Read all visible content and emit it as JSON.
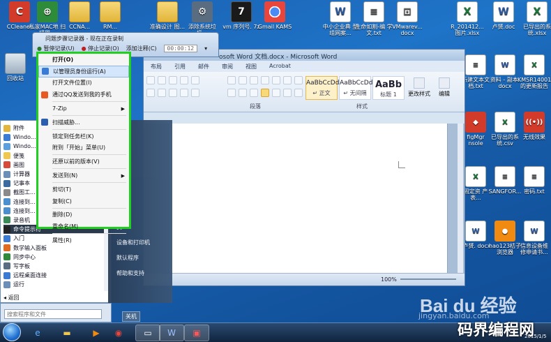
{
  "desktop_icons": [
    {
      "label": "CCleaner",
      "icon": "ccleaner-icon",
      "kind": "ico-red",
      "glyph": "C"
    },
    {
      "label": "私家MAC地 扫描器...",
      "icon": "scanner-icon",
      "kind": "ico-green",
      "glyph": "⊕"
    },
    {
      "label": "CCNA...",
      "icon": "folder-icon",
      "kind": "ico-folder",
      "glyph": ""
    },
    {
      "label": "RM...",
      "icon": "folder-icon",
      "kind": "ico-folder",
      "glyph": ""
    },
    {
      "label": "准确设计 图...",
      "icon": "folder-icon",
      "kind": "ico-folder",
      "glyph": ""
    },
    {
      "label": "添除系统垃 圾...",
      "icon": "gear-icon",
      "kind": "ico-gear",
      "glyph": "⚙"
    },
    {
      "label": "vm 序列号. 7z",
      "icon": "7z-icon",
      "kind": "ico-7z",
      "glyph": "7"
    },
    {
      "label": "Gmail KAMS",
      "icon": "chrome-icon",
      "kind": "ico-chrome",
      "glyph": ""
    },
    {
      "label": "中小企业典 型组网案...",
      "icon": "word-doc-icon",
      "kind": "ico-word",
      "glyph": "W"
    },
    {
      "label": "生命如割-编 学文.txt",
      "icon": "text-file-icon",
      "kind": "ico-text",
      "glyph": "≡"
    },
    {
      "label": "VMwarev... docx",
      "icon": "pdf-icon",
      "kind": "ico-text",
      "glyph": "⊡"
    },
    {
      "label": "R_201412... 图片.xlsx",
      "icon": "excel-icon",
      "kind": "ico-excel",
      "glyph": "X"
    },
    {
      "label": "卢赟.doc",
      "icon": "word-doc-icon",
      "kind": "ico-word",
      "glyph": "W"
    },
    {
      "label": "已导出的系 统.xlsx",
      "icon": "excel-icon",
      "kind": "ico-excel",
      "glyph": "X"
    }
  ],
  "right_icons": [
    {
      "label": "回收站",
      "icon": "recycle-bin-icon",
      "kind": "ico-bin",
      "glyph": ""
    },
    {
      "label": "新建文本文 档.txt",
      "icon": "text-file-icon",
      "kind": "ico-text",
      "glyph": "≡"
    },
    {
      "label": "资料 - 副本. docx",
      "icon": "word-doc-icon",
      "kind": "ico-word",
      "glyph": "W"
    },
    {
      "label": "KMSR14001 的更新报告",
      "icon": "excel-icon",
      "kind": "ico-excel",
      "glyph": "X"
    },
    {
      "label": "figMgr nsole",
      "icon": "app-icon",
      "kind": "ico-red",
      "glyph": "◆"
    },
    {
      "label": "已导出的系 统.csv",
      "icon": "excel-icon",
      "kind": "ico-excel",
      "glyph": "X"
    },
    {
      "label": "无线效果",
      "icon": "wifi-icon",
      "kind": "ico-red",
      "glyph": "((•))"
    },
    {
      "label": "固定资 产表...",
      "icon": "excel-icon",
      "kind": "ico-excel",
      "glyph": "X"
    },
    {
      "label": "SANGFOR...",
      "icon": "text-file-icon",
      "kind": "ico-text",
      "glyph": "≡"
    },
    {
      "label": "密码.txt",
      "icon": "text-file-icon",
      "kind": "ico-text",
      "glyph": "≡"
    },
    {
      "label": "-卢赟. docx",
      "icon": "word-doc-icon",
      "kind": "ico-word",
      "glyph": "W"
    },
    {
      "label": "hao123桔子 浏览器",
      "icon": "orange-browser-icon",
      "kind": "ico-orange",
      "glyph": "●"
    },
    {
      "label": "信息设备维 修申请书...",
      "icon": "word-doc-icon",
      "kind": "ico-word",
      "glyph": "W"
    }
  ],
  "recorder": {
    "title": "问题步骤记录器 - 现在正在录制",
    "pause": "暂停记录(U)",
    "stop": "停止记录(O)",
    "comment": "添加注释(C)",
    "timer": "00:00:12"
  },
  "context_menu": [
    {
      "label": "打开(O)",
      "bold": true,
      "hl": false,
      "sub": false,
      "sep_after": false
    },
    {
      "label": "以管理员身份运行(A)",
      "bold": false,
      "hl": true,
      "sub": false,
      "sep_after": false,
      "icon": "uac-shield-icon"
    },
    {
      "label": "打开文件位置(I)",
      "bold": false,
      "hl": false,
      "sub": false,
      "sep_after": false
    },
    {
      "label": "通过QQ发送到我的手机",
      "bold": false,
      "hl": false,
      "sub": false,
      "sep_after": true,
      "icon": "qq-icon"
    },
    {
      "label": "7-Zip",
      "bold": false,
      "hl": false,
      "sub": true,
      "sep_after": true
    },
    {
      "label": "扫描威胁...",
      "bold": false,
      "hl": false,
      "sub": false,
      "sep_after": true,
      "icon": "antivirus-icon"
    },
    {
      "label": "锁定到任务栏(K)",
      "bold": false,
      "hl": false,
      "sub": false,
      "sep_after": false
    },
    {
      "label": "附到「开始」菜单(U)",
      "bold": false,
      "hl": false,
      "sub": false,
      "sep_after": true
    },
    {
      "label": "还原以前的版本(V)",
      "bold": false,
      "hl": false,
      "sub": false,
      "sep_after": true
    },
    {
      "label": "发送到(N)",
      "bold": false,
      "hl": false,
      "sub": true,
      "sep_after": true
    },
    {
      "label": "剪切(T)",
      "bold": false,
      "hl": false,
      "sub": false,
      "sep_after": false
    },
    {
      "label": "复制(C)",
      "bold": false,
      "hl": false,
      "sub": false,
      "sep_after": true
    },
    {
      "label": "删除(D)",
      "bold": false,
      "hl": false,
      "sub": false,
      "sep_after": false
    },
    {
      "label": "重命名(M)",
      "bold": false,
      "hl": false,
      "sub": false,
      "sep_after": true
    },
    {
      "label": "属性(R)",
      "bold": false,
      "hl": false,
      "sub": false,
      "sep_after": false
    }
  ],
  "word": {
    "title": "osoft Word 文档.docx - Microsoft Word",
    "tabs": [
      "布局",
      "引用",
      "邮件",
      "审阅",
      "视图",
      "Acrobat"
    ],
    "styles": [
      {
        "sample": "AaBbCcDd",
        "name": "↵ 正文",
        "selected": true
      },
      {
        "sample": "AaBbCcDd",
        "name": "↵ 无间隔",
        "selected": false
      },
      {
        "sample": "AaBb",
        "name": "标题 1",
        "selected": false
      }
    ],
    "change_styles": "更改样式",
    "edit": "编辑",
    "group_paragraph": "段落",
    "group_styles": "样式",
    "zoom": "100%"
  },
  "start_menu": {
    "items": [
      {
        "label": "附件",
        "hl": false
      },
      {
        "label": "Windo...",
        "hl": false
      },
      {
        "label": "Windo...",
        "hl": false
      },
      {
        "label": "便笺",
        "hl": false
      },
      {
        "label": "画图",
        "hl": false
      },
      {
        "label": "计算器",
        "hl": false
      },
      {
        "label": "记事本",
        "hl": false
      },
      {
        "label": "截图工...",
        "hl": false
      },
      {
        "label": "连接到...",
        "hl": false
      },
      {
        "label": "连接到...",
        "hl": false
      },
      {
        "label": "录音机",
        "hl": false
      },
      {
        "label": "命令提示符",
        "hl": true
      },
      {
        "label": "入门",
        "hl": false
      },
      {
        "label": "数学输入面板",
        "hl": false
      },
      {
        "label": "同步中心",
        "hl": false
      },
      {
        "label": "写字板",
        "hl": false
      },
      {
        "label": "远程桌面连接",
        "hl": false
      },
      {
        "label": "运行",
        "hl": false
      }
    ],
    "back": "返回",
    "search_placeholder": "搜索程序和文件",
    "right_items": [
      "设备和打印机",
      "默认程序",
      "帮助和支持"
    ],
    "right_partial": "员",
    "shutdown": "关机"
  },
  "watermark": {
    "baidu": "Bai du 经验",
    "url": "jingyan.baidu.com",
    "site": "码界编程网"
  },
  "clock": "2015/1/5"
}
